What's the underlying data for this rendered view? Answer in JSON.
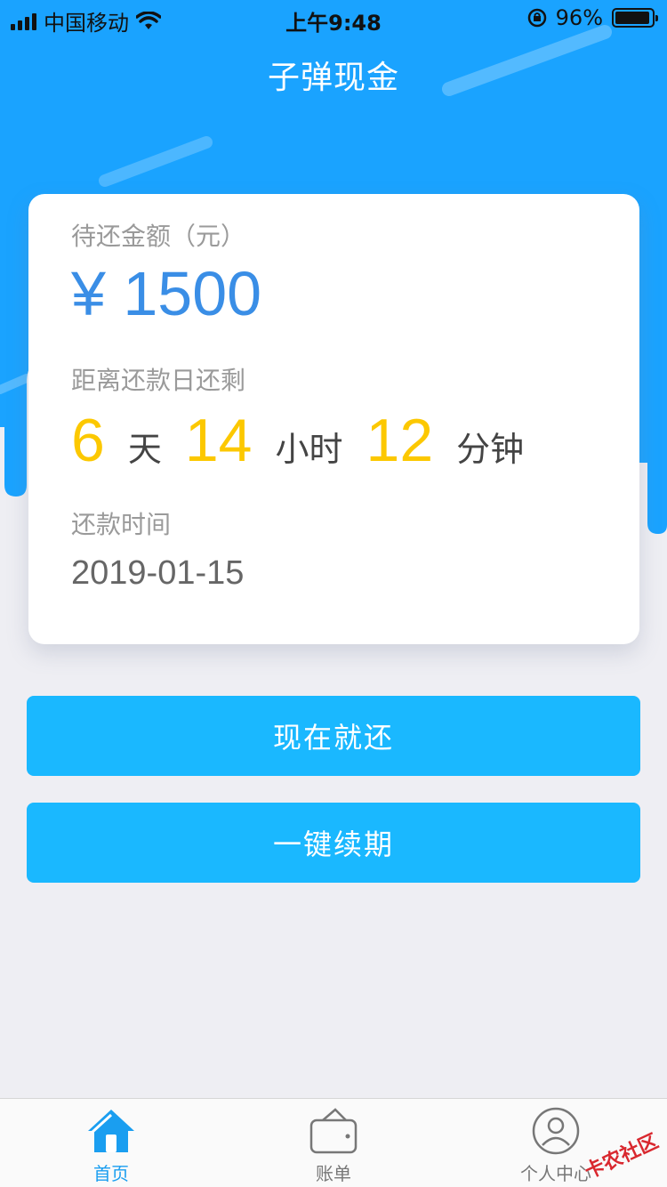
{
  "status_bar": {
    "carrier": "中国移动",
    "time": "上午9:48",
    "battery": "96%",
    "battery_level": 0.96
  },
  "header": {
    "title": "子弹现金"
  },
  "card": {
    "amount_label": "待还金额（元）",
    "amount": "¥ 1500",
    "countdown_label": "距离还款日还剩",
    "days": "6",
    "days_unit": "天",
    "hours": "14",
    "hours_unit": "小时",
    "minutes": "12",
    "minutes_unit": "分钟",
    "date_label": "还款时间",
    "date": "2019-01-15"
  },
  "actions": {
    "repay_now": "现在就还",
    "renew": "一键续期"
  },
  "tabbar": {
    "items": [
      {
        "label": "首页",
        "icon": "home-icon",
        "active": true
      },
      {
        "label": "账单",
        "icon": "wallet-icon",
        "active": false
      },
      {
        "label": "个人中心",
        "icon": "user-icon",
        "active": false
      }
    ]
  },
  "watermark": "卡农社区",
  "colors": {
    "primary": "#1ab8ff",
    "header_blue": "#1aa3ff",
    "amount": "#3a8ee6",
    "countdown": "#fcc800",
    "tab_active": "#1a9ef0"
  }
}
